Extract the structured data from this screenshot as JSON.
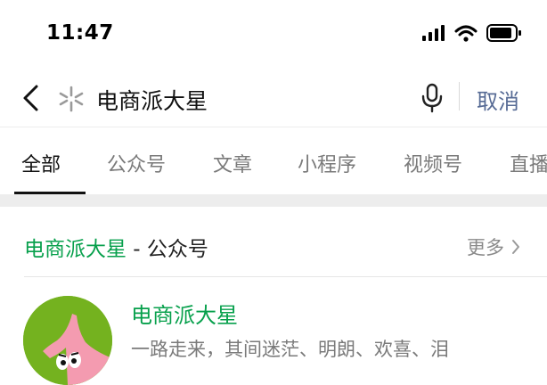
{
  "status_bar": {
    "time": "11:47"
  },
  "search": {
    "query": "电商派大星",
    "cancel_label": "取消"
  },
  "tabs": [
    {
      "label": "全部",
      "active": true
    },
    {
      "label": "公众号"
    },
    {
      "label": "文章"
    },
    {
      "label": "小程序"
    },
    {
      "label": "视频号"
    },
    {
      "label": "直播"
    }
  ],
  "section": {
    "keyword": "电商派大星",
    "title_suffix": " - 公众号",
    "more_label": "更多"
  },
  "result": {
    "name": "电商派大星",
    "description": "一路走来，其间迷茫、明朗、欢喜、泪"
  },
  "colors": {
    "accent_green": "#07a04c",
    "link_blue": "#576b95"
  }
}
